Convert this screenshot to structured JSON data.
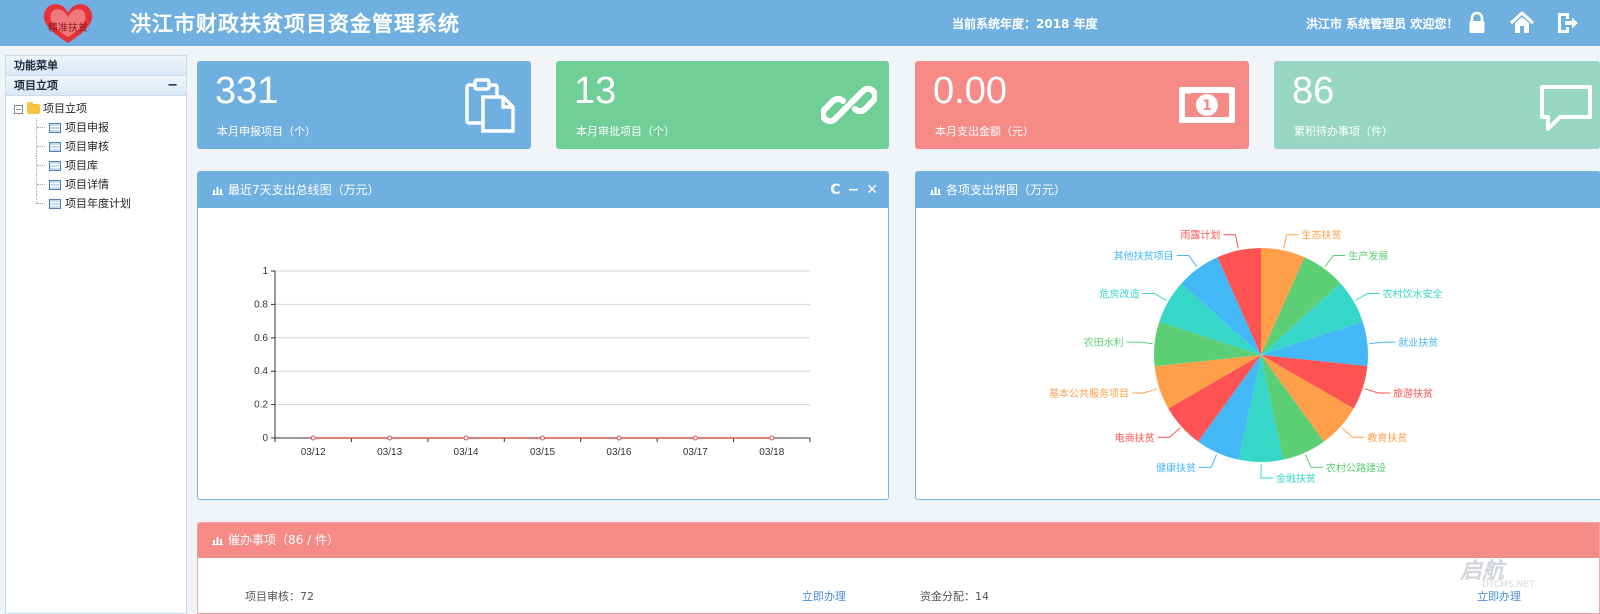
{
  "header": {
    "logo_text": "精准扶贫",
    "title": "洪江市财政扶贫项目资金管理系统",
    "year_text": "当前系统年度：2018 年度",
    "welcome_text": "洪江市 系统管理员 欢迎您！",
    "icons": [
      "lock-icon",
      "home-icon",
      "logout-icon"
    ]
  },
  "sidebar": {
    "menu_title": "功能菜单",
    "section_title": "项目立项",
    "collapse_label": "−",
    "root": "项目立项",
    "items": [
      {
        "label": "项目申报"
      },
      {
        "label": "项目审核"
      },
      {
        "label": "项目库"
      },
      {
        "label": "项目详情"
      },
      {
        "label": "项目年度计划"
      }
    ]
  },
  "stats": [
    {
      "value": "331",
      "label": "本月申报项目（个）",
      "color": "#6fb0e0",
      "icon": "clipboard-icon"
    },
    {
      "value": "13",
      "label": "本月审批项目（个）",
      "color": "#6fcf96",
      "icon": "link-icon"
    },
    {
      "value": "0.00",
      "label": "本月支出金额（元）",
      "color": "#f58a87",
      "icon": "money-icon"
    },
    {
      "value": "86",
      "label": "累积待办事项（件）",
      "color": "#98d6c4",
      "icon": "comment-icon"
    }
  ],
  "line_panel": {
    "title": "最近7天支出总线图（万元）",
    "tools": [
      "C",
      "−",
      "✕"
    ]
  },
  "pie_panel": {
    "title": "各项支出饼图（万元）"
  },
  "chart_data": [
    {
      "type": "line",
      "title": "最近7天支出总线图（万元）",
      "x": [
        "03/12",
        "03/13",
        "03/14",
        "03/15",
        "03/16",
        "03/17",
        "03/18"
      ],
      "yticks": [
        "0",
        "0.2",
        "0.4",
        "0.6",
        "0.8",
        "1"
      ],
      "ylim": [
        0,
        1
      ],
      "series": [
        {
          "values": [
            0,
            0,
            0,
            0,
            0,
            0,
            0
          ],
          "color": "#d9534f"
        }
      ],
      "grid": true
    },
    {
      "type": "pie",
      "title": "各项支出饼图（万元）",
      "slices": [
        {
          "label": "生态扶贫",
          "value": 1,
          "color": "#ff9f4a"
        },
        {
          "label": "生产发展",
          "value": 1,
          "color": "#5cce74"
        },
        {
          "label": "农村饮水安全",
          "value": 1,
          "color": "#36d6c8"
        },
        {
          "label": "就业扶贫",
          "value": 1,
          "color": "#44b7f7"
        },
        {
          "label": "旅游扶贫",
          "value": 1,
          "color": "#ff5252"
        },
        {
          "label": "教育扶贫",
          "value": 1,
          "color": "#ff9f4a"
        },
        {
          "label": "农村公路建设",
          "value": 1,
          "color": "#5cce74"
        },
        {
          "label": "金融扶贫",
          "value": 1,
          "color": "#36d6c8"
        },
        {
          "label": "健康扶贫",
          "value": 1,
          "color": "#44b7f7"
        },
        {
          "label": "电商扶贫",
          "value": 1,
          "color": "#ff5252"
        },
        {
          "label": "基本公共服务项目",
          "value": 1,
          "color": "#ff9f4a"
        },
        {
          "label": "农田水利",
          "value": 1,
          "color": "#5cce74"
        },
        {
          "label": "危房改造",
          "value": 1,
          "color": "#36d6c8"
        },
        {
          "label": "其他扶贫项目",
          "value": 1,
          "color": "#44b7f7"
        },
        {
          "label": "雨露计划",
          "value": 1,
          "color": "#ff5252"
        }
      ]
    }
  ],
  "todo": {
    "title": "催办事项（86 / 件）",
    "items": [
      {
        "text": "项目审核：72",
        "action": "立即办理"
      },
      {
        "text": "资金分配：14",
        "action": "立即办理"
      }
    ]
  },
  "watermark": {
    "text": "启航",
    "sub": "DTCMS.NET"
  }
}
